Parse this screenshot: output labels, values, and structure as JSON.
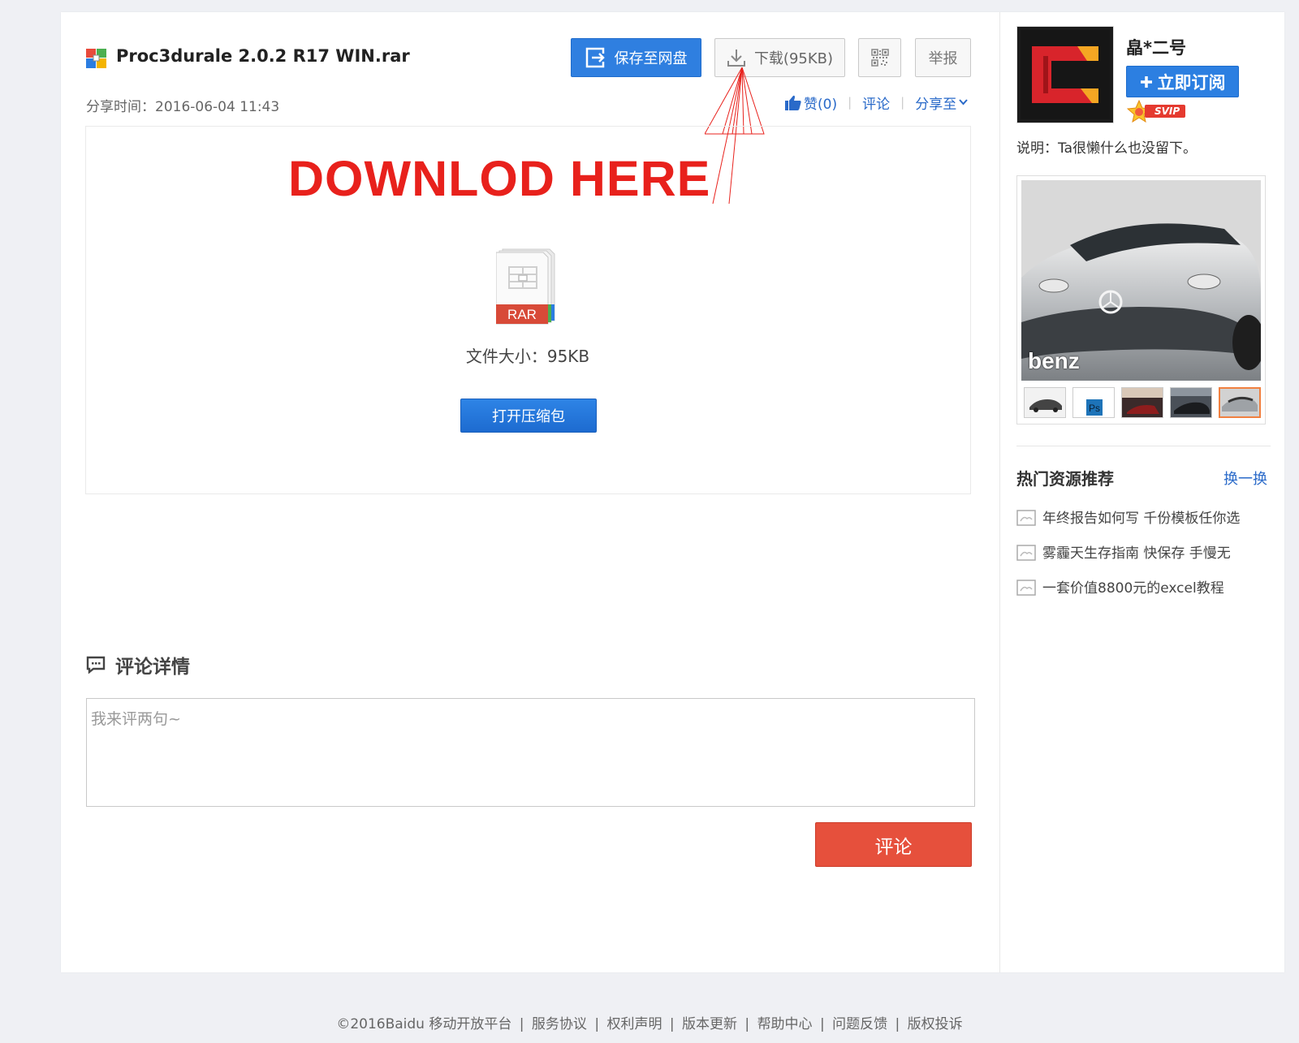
{
  "file": {
    "title": "Proc3durale 2.0.2 R17 WIN.rar",
    "share_time": "分享时间：2016-06-04 11:43",
    "size_label": "文件大小：95KB",
    "icon_label": "RAR"
  },
  "toolbar": {
    "save_label": "保存至网盘",
    "download_label": "下载(95KB)",
    "report_label": "举报"
  },
  "actions": {
    "like_label": "赞(0)",
    "comment_label": "评论",
    "share_label": "分享至"
  },
  "annotation": {
    "text": "DOWNLOD HERE"
  },
  "open_button": "打开压缩包",
  "comments": {
    "title": "评论详情",
    "placeholder": "我来评两句~",
    "submit_label": "评论"
  },
  "sidebar": {
    "username": "皛*二号",
    "subscribe_label": "立即订阅",
    "svip_label": "SVIP",
    "bio": "说明：Ta很懒什么也没留下。",
    "gallery_caption": "benz",
    "hot": {
      "title": "热门资源推荐",
      "refresh_label": "换一换",
      "items": [
        {
          "label": "年终报告如何写 千份模板任你选"
        },
        {
          "label": "雾霾天生存指南 快保存 手慢无"
        },
        {
          "label": "一套价值8800元的excel教程"
        }
      ]
    }
  },
  "footer": {
    "copyright": "©2016Baidu",
    "links": [
      "移动开放平台",
      "服务协议",
      "权利声明",
      "版本更新",
      "帮助中心",
      "问题反馈",
      "版权投诉"
    ]
  },
  "colors": {
    "accent_blue": "#2f7fe0",
    "link_blue": "#2a6ac9",
    "comment_red": "#e6503c",
    "annotation_red": "#e8211c"
  }
}
